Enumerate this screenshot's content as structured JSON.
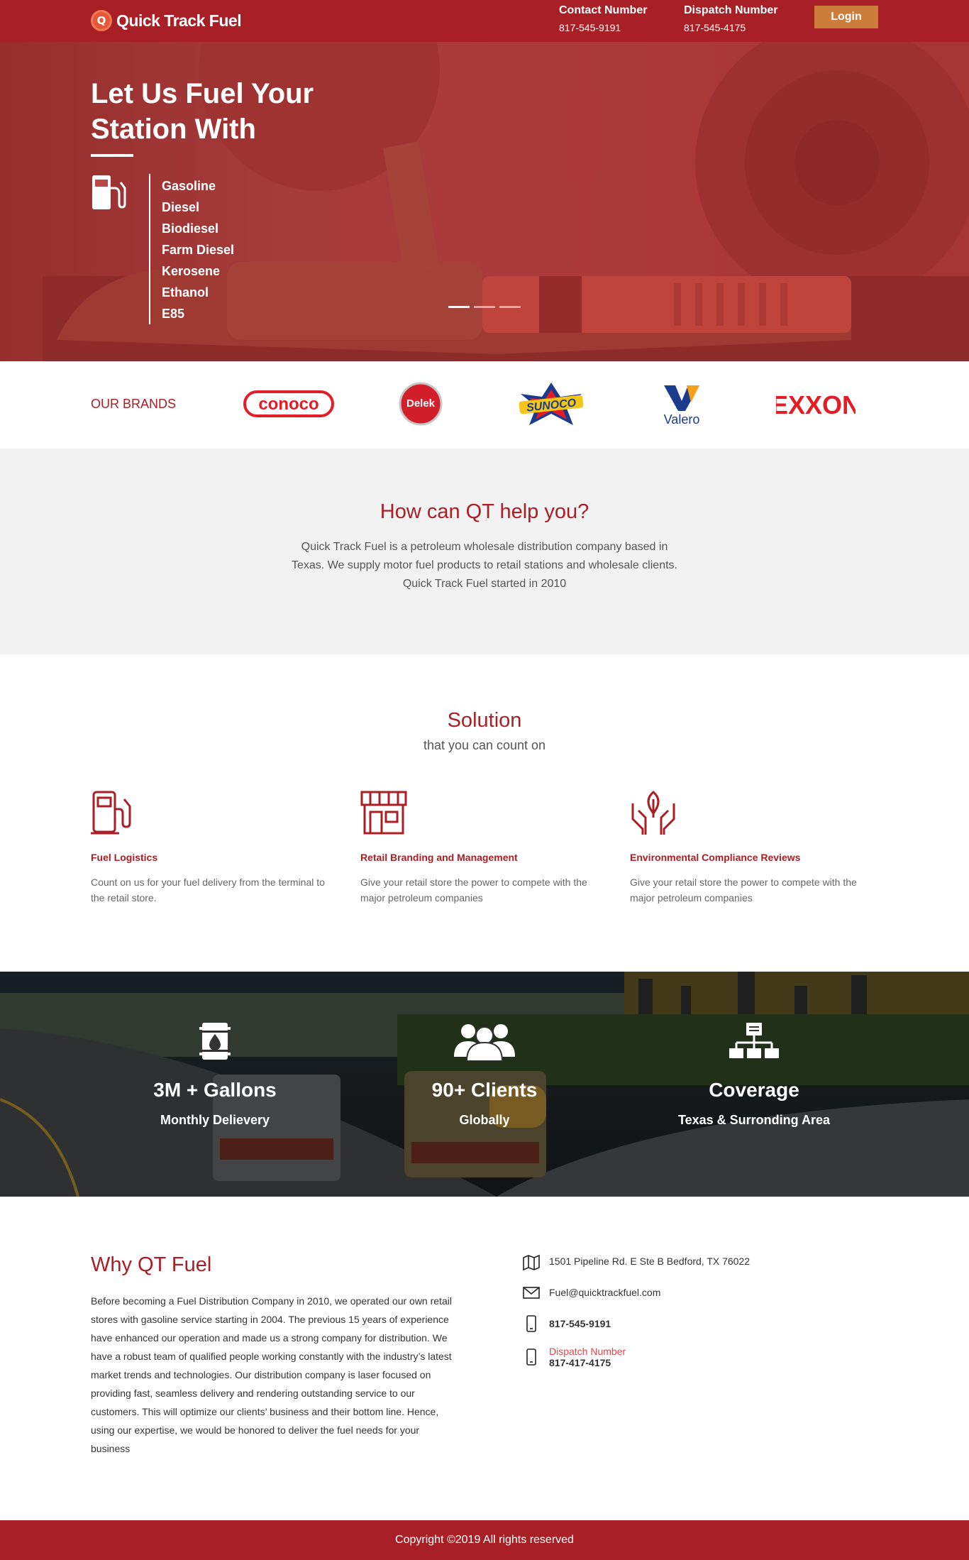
{
  "header": {
    "logo_text": "Quick Track Fuel",
    "logo_letter": "Q",
    "contact_label": "Contact Number",
    "contact_number": "817-545-9191",
    "dispatch_label": "Dispatch Number",
    "dispatch_number": "817-545-4175",
    "login_label": "Login"
  },
  "hero": {
    "title": "Let Us Fuel Your Station With",
    "fuels": [
      "Gasoline",
      "Diesel",
      "Biodiesel",
      "Farm Diesel",
      "Kerosene",
      "Ethanol",
      "E85"
    ],
    "slide_count": 3,
    "active_slide": 1
  },
  "brands": {
    "label": "OUR BRANDS",
    "items": [
      "conoco",
      "Delek",
      "SUNOCO",
      "Valero",
      "EXXON"
    ]
  },
  "help": {
    "title": "How can QT help you?",
    "text": "Quick Track Fuel is a petroleum wholesale distribution company based in Texas. We supply motor fuel products to retail stations and wholesale clients. Quick Track Fuel started in 2010"
  },
  "solution": {
    "title": "Solution",
    "subtitle": "that you can count on",
    "items": [
      {
        "icon": "fuel-pump-icon",
        "title": "Fuel Logistics",
        "text": "Count on us for your fuel delivery from the terminal to the retail store."
      },
      {
        "icon": "storefront-icon",
        "title": "Retail Branding and Management",
        "text": "Give your retail store the power to compete with the major petroleum companies"
      },
      {
        "icon": "leaf-hands-icon",
        "title": "Environmental Compliance Reviews",
        "text": "Give your retail store the power to compete with the major petroleum companies"
      }
    ]
  },
  "stats": [
    {
      "icon": "oil-barrel-icon",
      "big": "3M + Gallons",
      "small": "Monthly Delievery"
    },
    {
      "icon": "group-icon",
      "big": "90+ Clients",
      "small": "Globally"
    },
    {
      "icon": "network-icon",
      "big": "Coverage",
      "small": "Texas & Surronding Area"
    }
  ],
  "why": {
    "title": "Why QT Fuel",
    "text": "Before becoming a Fuel Distribution Company in 2010, we operated our own retail stores with gasoline service starting in 2004.  The previous 15 years of experience have enhanced our operation and made us a strong company for distribution.  We have a robust team of qualified people working constantly with the industry’s latest market trends and technologies.  Our distribution company is laser focused on providing fast, seamless delivery and rendering outstanding service to our customers.  This will optimize our clients’ business and their bottom line.  Hence, using our expertise, we would be honored to deliver the fuel needs for your business",
    "address": "1501 Pipeline Rd. E Ste B Bedford, TX 76022",
    "email": "Fuel@quicktrackfuel.com",
    "phone": "817-545-9191",
    "dispatch_label": "Dispatch Number",
    "dispatch_phone": "817-417-4175"
  },
  "footer": {
    "copyright": "Copyright ©2019 All rights reserved"
  },
  "colors": {
    "brand_red": "#a91f26",
    "login_orange": "#cd7d3b",
    "light_gray": "#f2f2f2",
    "accent_red": "#e0464e"
  }
}
